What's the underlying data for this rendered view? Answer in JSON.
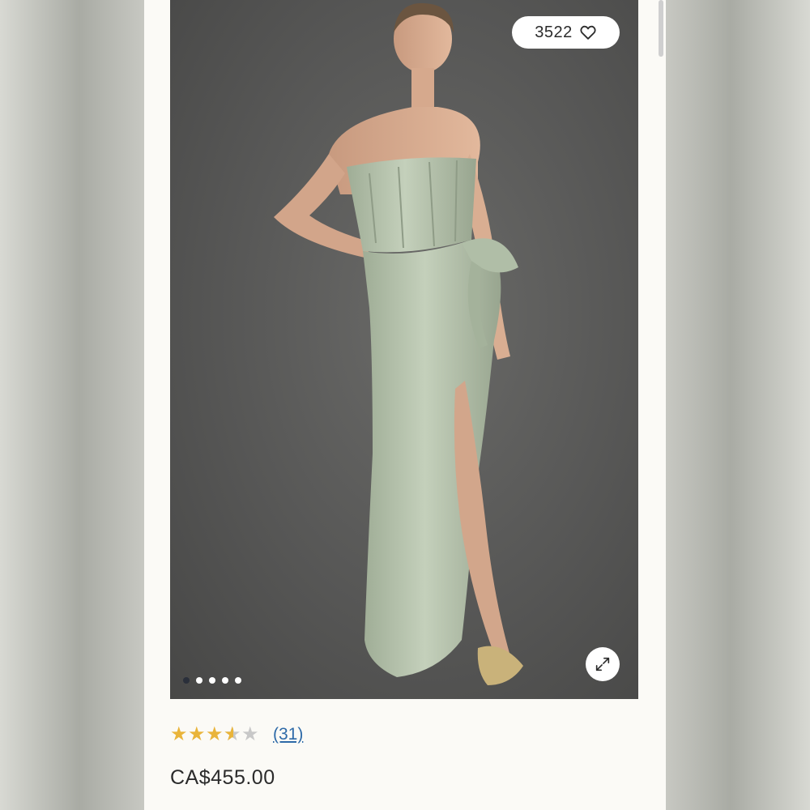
{
  "product": {
    "like_count": "3522",
    "like_icon": "heart-outline-icon",
    "expand_icon": "expand-arrows-icon",
    "gallery": {
      "image_count": 5,
      "active_index": 0
    },
    "dress_color": "#b7c4ad",
    "rating": {
      "value": 3.5,
      "max": 5,
      "review_count_label": "(31)"
    },
    "price": "CA$455.00"
  },
  "colors": {
    "star_filled": "#e9b43a",
    "star_empty": "#c8c8c8",
    "link": "#2e6aa8",
    "page_background": "#fbfaf6"
  }
}
